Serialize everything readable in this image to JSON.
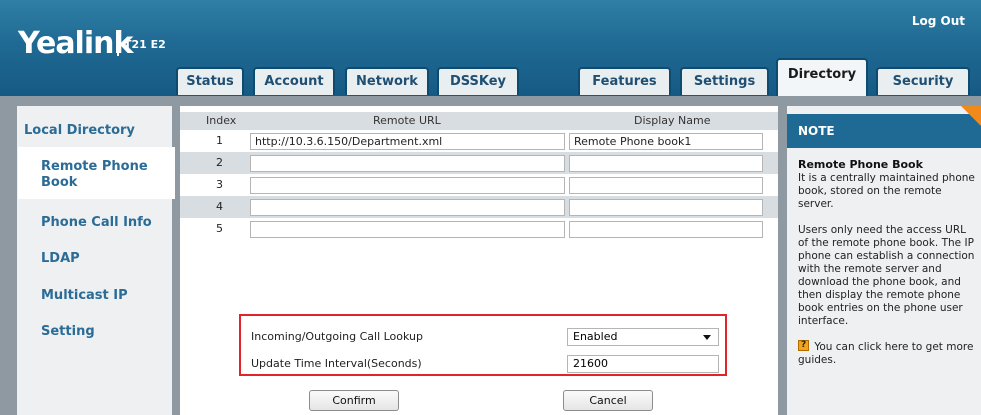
{
  "header": {
    "brand": "Yealink",
    "model": "T21 E2",
    "logout": "Log Out"
  },
  "tabs": [
    "Status",
    "Account",
    "Network",
    "DSSKey",
    "Features",
    "Settings",
    "Directory",
    "Security"
  ],
  "active_tab": "Directory",
  "sidebar": {
    "items": [
      "Local Directory",
      "Remote Phone Book",
      "Phone Call Info",
      "LDAP",
      "Multicast IP",
      "Setting"
    ],
    "active": "Remote Phone Book"
  },
  "table": {
    "headers": [
      "Index",
      "Remote URL",
      "Display Name"
    ],
    "rows": [
      {
        "index": "1",
        "url": "http://10.3.6.150/Department.xml",
        "name": "Remote Phone book1"
      },
      {
        "index": "2",
        "url": "",
        "name": ""
      },
      {
        "index": "3",
        "url": "",
        "name": ""
      },
      {
        "index": "4",
        "url": "",
        "name": ""
      },
      {
        "index": "5",
        "url": "",
        "name": ""
      }
    ]
  },
  "settings": {
    "lookup_label": "Incoming/Outgoing Call Lookup",
    "lookup_value": "Enabled",
    "interval_label": "Update Time Interval(Seconds)",
    "interval_value": "21600"
  },
  "buttons": {
    "confirm": "Confirm",
    "cancel": "Cancel"
  },
  "note": {
    "title": "NOTE",
    "heading": "Remote Phone Book",
    "p1": "It is a centrally maintained phone book, stored on the remote server.",
    "p2": "Users only need the access URL of the remote phone book. The IP phone can establish a connection with the remote server and download the phone book, and then display the remote phone book entries on the phone user interface.",
    "guide": "You can click here to get more guides."
  },
  "colors": {
    "header": "#1f6a94",
    "accent": "#f28a1b",
    "highlight_border": "#e1242b",
    "side_link": "#2b6c97"
  }
}
